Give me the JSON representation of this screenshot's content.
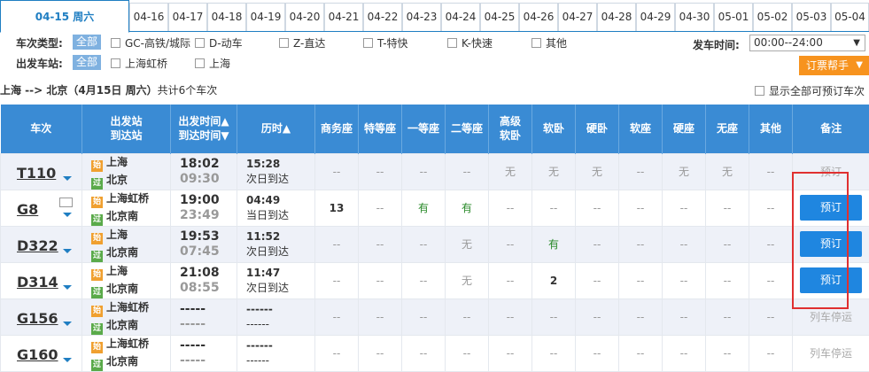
{
  "dates": [
    {
      "label": "04-15  周六",
      "active": true
    },
    {
      "label": "04-16"
    },
    {
      "label": "04-17"
    },
    {
      "label": "04-18"
    },
    {
      "label": "04-19"
    },
    {
      "label": "04-20"
    },
    {
      "label": "04-21"
    },
    {
      "label": "04-22"
    },
    {
      "label": "04-23"
    },
    {
      "label": "04-24"
    },
    {
      "label": "04-25"
    },
    {
      "label": "04-26"
    },
    {
      "label": "04-27"
    },
    {
      "label": "04-28"
    },
    {
      "label": "04-29"
    },
    {
      "label": "04-30"
    },
    {
      "label": "05-01"
    },
    {
      "label": "05-02"
    },
    {
      "label": "05-03"
    },
    {
      "label": "05-04"
    }
  ],
  "filters": {
    "train_type_label": "车次类型:",
    "all_chip": "全部",
    "types": [
      "GC-高铁/城际",
      "D-动车",
      "Z-直达",
      "T-特快",
      "K-快速",
      "其他"
    ],
    "depart_station_label": "出发车站:",
    "stations": [
      "上海虹桥",
      "上海"
    ],
    "depart_time_label": "发车时间:",
    "depart_time_value": "00:00--24:00",
    "help_label": "订票帮手"
  },
  "route": {
    "text": "上海 --> 北京（4月15日  周六）",
    "count": "共计6个车次",
    "show_all": "显示全部可预订车次"
  },
  "headers": {
    "train": "车次",
    "stations_a": "出发站",
    "stations_b": "到达站",
    "time_a": "出发时间▲",
    "time_b": "到达时间▼",
    "duration": "历时▲",
    "business": "商务座",
    "premium": "特等座",
    "first": "一等座",
    "second": "二等座",
    "soft_sleeper_hi_a": "高级",
    "soft_sleeper_hi_b": "软卧",
    "soft_sleeper": "软卧",
    "hard_sleeper": "硬卧",
    "soft_seat": "软座",
    "hard_seat": "硬座",
    "no_seat": "无座",
    "other": "其他",
    "note": "备注"
  },
  "badges": {
    "start": "始",
    "pass": "过"
  },
  "trains": [
    {
      "no": "T110",
      "from": "上海",
      "to": "北京",
      "dep": "18:02",
      "arr": "09:30",
      "dur": "15:28",
      "arrive_day": "次日到达",
      "seats": [
        "--",
        "--",
        "--",
        "--",
        "无",
        "无",
        "无",
        "--",
        "无",
        "无",
        "--"
      ],
      "note": "预订",
      "bookable": false
    },
    {
      "no": "G8",
      "from": "上海虹桥",
      "to": "北京南",
      "dep": "19:00",
      "arr": "23:49",
      "dur": "04:49",
      "arrive_day": "当日到达",
      "seats": [
        "13",
        "--",
        "有",
        "有",
        "--",
        "--",
        "--",
        "--",
        "--",
        "--",
        "--"
      ],
      "note": "预订",
      "bookable": true
    },
    {
      "no": "D322",
      "from": "上海",
      "to": "北京南",
      "dep": "19:53",
      "arr": "07:45",
      "dur": "11:52",
      "arrive_day": "次日到达",
      "seats": [
        "--",
        "--",
        "--",
        "无",
        "--",
        "有",
        "--",
        "--",
        "--",
        "--",
        "--"
      ],
      "note": "预订",
      "bookable": true
    },
    {
      "no": "D314",
      "from": "上海",
      "to": "北京南",
      "dep": "21:08",
      "arr": "08:55",
      "dur": "11:47",
      "arrive_day": "次日到达",
      "seats": [
        "--",
        "--",
        "--",
        "无",
        "--",
        "2",
        "--",
        "--",
        "--",
        "--",
        "--"
      ],
      "note": "预订",
      "bookable": true
    },
    {
      "no": "G156",
      "from": "上海虹桥",
      "to": "北京南",
      "dep": "-----",
      "arr": "-----",
      "dur": "------",
      "arrive_day": "------",
      "seats": [
        "--",
        "--",
        "--",
        "--",
        "--",
        "--",
        "--",
        "--",
        "--",
        "--",
        "--"
      ],
      "note": "列车停运",
      "bookable": false
    },
    {
      "no": "G160",
      "from": "上海虹桥",
      "to": "北京南",
      "dep": "-----",
      "arr": "-----",
      "dur": "------",
      "arrive_day": "------",
      "seats": [
        "--",
        "--",
        "--",
        "--",
        "--",
        "--",
        "--",
        "--",
        "--",
        "--",
        "--"
      ],
      "note": "列车停运",
      "bookable": false
    }
  ],
  "colors": {
    "header_blue": "#3a8bd4",
    "accent": "#1f7ec2",
    "book_button": "#1f86e0",
    "help_orange": "#f7931e",
    "available_green": "#2a8a2a",
    "highlight_red": "#e03030"
  }
}
